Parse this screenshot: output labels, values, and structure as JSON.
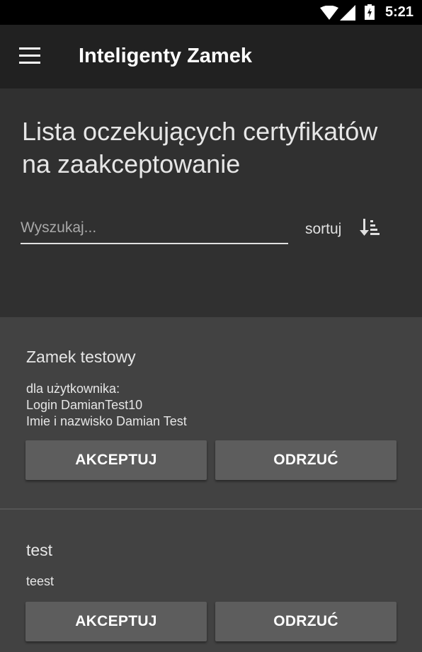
{
  "status_bar": {
    "time": "5:21"
  },
  "app_bar": {
    "title": "Inteligenty Zamek",
    "menu_icon": "hamburger-menu-icon"
  },
  "page": {
    "title_line1": "Lista oczekujących certyfikatów",
    "title_line2": "na zaakceptowanie"
  },
  "search": {
    "placeholder": "Wyszukaj...",
    "value": ""
  },
  "sort": {
    "label": "sortuj",
    "icon": "sort-descending-icon"
  },
  "cards": [
    {
      "title": "Zamek testowy",
      "lines": [
        "dla użytkownika:",
        "Login DamianTest10",
        "Imie i nazwisko  Damian Test"
      ],
      "accept_label": "AKCEPTUJ",
      "reject_label": "ODRZUĆ"
    },
    {
      "title": "test",
      "lines": [
        "teest"
      ],
      "accept_label": "AKCEPTUJ",
      "reject_label": "ODRZUĆ"
    }
  ],
  "colors": {
    "background": "#303030",
    "app_bar": "#212121",
    "card": "#424242",
    "button": "#5d5d5d"
  }
}
